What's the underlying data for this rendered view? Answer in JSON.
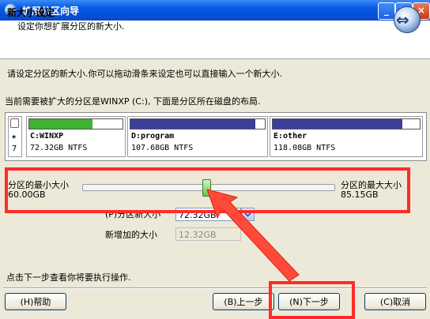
{
  "window": {
    "title": "扩展分区向导"
  },
  "header": {
    "title": "新大小设定",
    "subtitle": "设定你想扩展分区的新大小."
  },
  "instructions": {
    "line1": "请设定分区的新大小.你可以拖动滑条来设定也可以直接输入一个新大小.",
    "line2": "当前需要被扩大的分区是WINXP (C:), 下面是分区所在磁盘的布局."
  },
  "disk": {
    "left_marker_top": "*",
    "left_marker_bottom": "7",
    "partitions": [
      {
        "name": "C:WINXP",
        "info": "72.32GB NTFS",
        "bar_color": "#3fb232",
        "fill": 0.68
      },
      {
        "name": "D:program",
        "info": "107.68GB NTFS",
        "bar_color": "#3b3f9a",
        "fill": 0.93
      },
      {
        "name": "E:other",
        "info": "118.08GB NTFS",
        "bar_color": "#3b3f9a",
        "fill": 0.88
      }
    ]
  },
  "slider": {
    "min_label": "分区的最小大小",
    "min_value": "60.00GB",
    "max_label": "分区的最大大小",
    "max_value": "85.15GB",
    "position": 0.5
  },
  "form": {
    "new_size_label": "(P)分区新大小",
    "new_size_value": "72.32GB",
    "added_size_label": "新增加的大小",
    "added_size_value": "12.32GB"
  },
  "footer": {
    "hint": "点击下一步查看你将要执行操作."
  },
  "buttons": {
    "help": "(H)帮助",
    "back": "(B)上一步",
    "next": "(N)下一步",
    "cancel": "(C)取消"
  },
  "colors": {
    "highlight": "#ff2b2b"
  }
}
